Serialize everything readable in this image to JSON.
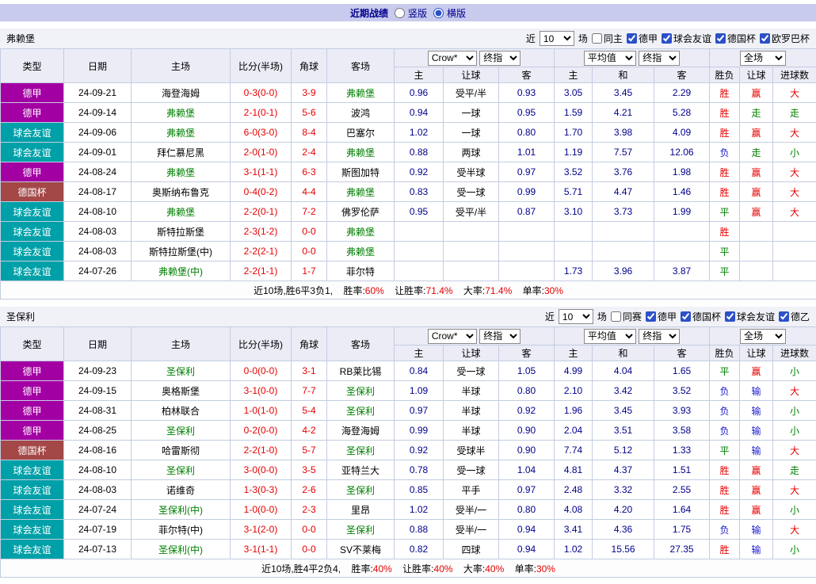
{
  "topbar": {
    "title": "近期战绩",
    "layout_options": [
      {
        "label": "竖版",
        "selected": false
      },
      {
        "label": "横版",
        "selected": true
      }
    ]
  },
  "colors": {
    "accent_bar": "#c8caee",
    "type_badges": {
      "德甲": "#a300a3",
      "球会友谊": "#00a0a8",
      "德国杯": "#a34747"
    },
    "results": {
      "胜": "#e60000",
      "赢": "#e60000",
      "大": "#e60000",
      "平": "#008000",
      "走": "#008000",
      "小": "#008000",
      "负": "#1a1acc",
      "输": "#1a1acc"
    }
  },
  "table_header": {
    "type": "类型",
    "date": "日期",
    "home": "主场",
    "score": "比分(半场)",
    "corner": "角球",
    "away": "客场",
    "odds_source_select": "Crow*",
    "odds_index_select": "终指",
    "avg_select": "平均值",
    "avg_index_select": "终指",
    "scope_select": "全场",
    "sub_headers": [
      "主",
      "让球",
      "客",
      "主",
      "和",
      "客",
      "胜负",
      "让球",
      "进球数"
    ]
  },
  "sections": [
    {
      "team": "弗赖堡",
      "filter": {
        "near": "近",
        "count": "10",
        "games": "场",
        "same": {
          "label": "同主",
          "checked": false
        },
        "leagues": [
          {
            "label": "德甲",
            "checked": true
          },
          {
            "label": "球会友谊",
            "checked": true
          },
          {
            "label": "德国杯",
            "checked": true
          },
          {
            "label": "欧罗巴杯",
            "checked": true
          }
        ]
      },
      "rows": [
        {
          "type": "德甲",
          "date": "24-09-21",
          "home": "海登海姆",
          "home_focus": false,
          "score": "0-3(0-0)",
          "corner": "3-9",
          "away": "弗赖堡",
          "away_focus": true,
          "odds": [
            "0.96",
            "受平/半",
            "0.93"
          ],
          "avg": [
            "3.05",
            "3.45",
            "2.29"
          ],
          "results": [
            "胜",
            "赢",
            "大"
          ]
        },
        {
          "type": "德甲",
          "date": "24-09-14",
          "home": "弗赖堡",
          "home_focus": true,
          "score": "2-1(0-1)",
          "corner": "5-6",
          "away": "波鸿",
          "away_focus": false,
          "odds": [
            "0.94",
            "一球",
            "0.95"
          ],
          "avg": [
            "1.59",
            "4.21",
            "5.28"
          ],
          "results": [
            "胜",
            "走",
            "走"
          ]
        },
        {
          "type": "球会友谊",
          "date": "24-09-06",
          "home": "弗赖堡",
          "home_focus": true,
          "score": "6-0(3-0)",
          "corner": "8-4",
          "away": "巴塞尔",
          "away_focus": false,
          "odds": [
            "1.02",
            "一球",
            "0.80"
          ],
          "avg": [
            "1.70",
            "3.98",
            "4.09"
          ],
          "results": [
            "胜",
            "赢",
            "大"
          ]
        },
        {
          "type": "球会友谊",
          "date": "24-09-01",
          "home": "拜仁慕尼黑",
          "home_focus": false,
          "score": "2-0(1-0)",
          "corner": "2-4",
          "away": "弗赖堡",
          "away_focus": true,
          "odds": [
            "0.88",
            "两球",
            "1.01"
          ],
          "avg": [
            "1.19",
            "7.57",
            "12.06"
          ],
          "results": [
            "负",
            "走",
            "小"
          ]
        },
        {
          "type": "德甲",
          "date": "24-08-24",
          "home": "弗赖堡",
          "home_focus": true,
          "score": "3-1(1-1)",
          "corner": "6-3",
          "away": "斯图加特",
          "away_focus": false,
          "odds": [
            "0.92",
            "受半球",
            "0.97"
          ],
          "avg": [
            "3.52",
            "3.76",
            "1.98"
          ],
          "results": [
            "胜",
            "赢",
            "大"
          ]
        },
        {
          "type": "德国杯",
          "date": "24-08-17",
          "home": "奥斯纳布鲁克",
          "home_focus": false,
          "score": "0-4(0-2)",
          "corner": "4-4",
          "away": "弗赖堡",
          "away_focus": true,
          "odds": [
            "0.83",
            "受一球",
            "0.99"
          ],
          "avg": [
            "5.71",
            "4.47",
            "1.46"
          ],
          "results": [
            "胜",
            "赢",
            "大"
          ]
        },
        {
          "type": "球会友谊",
          "date": "24-08-10",
          "home": "弗赖堡",
          "home_focus": true,
          "score": "2-2(0-1)",
          "corner": "7-2",
          "away": "佛罗伦萨",
          "away_focus": false,
          "odds": [
            "0.95",
            "受平/半",
            "0.87"
          ],
          "avg": [
            "3.10",
            "3.73",
            "1.99"
          ],
          "results": [
            "平",
            "赢",
            "大"
          ]
        },
        {
          "type": "球会友谊",
          "date": "24-08-03",
          "home": "斯特拉斯堡",
          "home_focus": false,
          "score": "2-3(1-2)",
          "corner": "0-0",
          "away": "弗赖堡",
          "away_focus": true,
          "odds": [
            "",
            "",
            ""
          ],
          "avg": [
            "",
            "",
            ""
          ],
          "results": [
            "胜",
            "",
            ""
          ]
        },
        {
          "type": "球会友谊",
          "date": "24-08-03",
          "home": "斯特拉斯堡(中)",
          "home_focus": false,
          "score": "2-2(2-1)",
          "corner": "0-0",
          "away": "弗赖堡",
          "away_focus": true,
          "odds": [
            "",
            "",
            ""
          ],
          "avg": [
            "",
            "",
            ""
          ],
          "results": [
            "平",
            "",
            ""
          ]
        },
        {
          "type": "球会友谊",
          "date": "24-07-26",
          "home": "弗赖堡(中)",
          "home_focus": true,
          "score": "2-2(1-1)",
          "corner": "1-7",
          "away": "菲尔特",
          "away_focus": false,
          "odds": [
            "",
            "",
            ""
          ],
          "avg": [
            "1.73",
            "3.96",
            "3.87"
          ],
          "results": [
            "平",
            "",
            ""
          ]
        }
      ],
      "summary": {
        "prefix": "近10场,胜6平3负1,",
        "stats": [
          {
            "label": "胜率:",
            "value": "60%"
          },
          {
            "label": "让胜率:",
            "value": "71.4%"
          },
          {
            "label": "大率:",
            "value": "71.4%"
          },
          {
            "label": "单率:",
            "value": "30%"
          }
        ]
      }
    },
    {
      "team": "圣保利",
      "filter": {
        "near": "近",
        "count": "10",
        "games": "场",
        "same": {
          "label": "同赛",
          "checked": false
        },
        "leagues": [
          {
            "label": "德甲",
            "checked": true
          },
          {
            "label": "德国杯",
            "checked": true
          },
          {
            "label": "球会友谊",
            "checked": true
          },
          {
            "label": "德乙",
            "checked": true
          }
        ]
      },
      "rows": [
        {
          "type": "德甲",
          "date": "24-09-23",
          "home": "圣保利",
          "home_focus": true,
          "score": "0-0(0-0)",
          "corner": "3-1",
          "away": "RB莱比锡",
          "away_focus": false,
          "odds": [
            "0.84",
            "受一球",
            "1.05"
          ],
          "avg": [
            "4.99",
            "4.04",
            "1.65"
          ],
          "results": [
            "平",
            "赢",
            "小"
          ]
        },
        {
          "type": "德甲",
          "date": "24-09-15",
          "home": "奥格斯堡",
          "home_focus": false,
          "score": "3-1(0-0)",
          "corner": "7-7",
          "away": "圣保利",
          "away_focus": true,
          "odds": [
            "1.09",
            "半球",
            "0.80"
          ],
          "avg": [
            "2.10",
            "3.42",
            "3.52"
          ],
          "results": [
            "负",
            "输",
            "大"
          ]
        },
        {
          "type": "德甲",
          "date": "24-08-31",
          "home": "柏林联合",
          "home_focus": false,
          "score": "1-0(1-0)",
          "corner": "5-4",
          "away": "圣保利",
          "away_focus": true,
          "odds": [
            "0.97",
            "半球",
            "0.92"
          ],
          "avg": [
            "1.96",
            "3.45",
            "3.93"
          ],
          "results": [
            "负",
            "输",
            "小"
          ]
        },
        {
          "type": "德甲",
          "date": "24-08-25",
          "home": "圣保利",
          "home_focus": true,
          "score": "0-2(0-0)",
          "corner": "4-2",
          "away": "海登海姆",
          "away_focus": false,
          "odds": [
            "0.99",
            "半球",
            "0.90"
          ],
          "avg": [
            "2.04",
            "3.51",
            "3.58"
          ],
          "results": [
            "负",
            "输",
            "小"
          ]
        },
        {
          "type": "德国杯",
          "date": "24-08-16",
          "home": "哈雷斯彻",
          "home_focus": false,
          "score": "2-2(1-0)",
          "corner": "5-7",
          "away": "圣保利",
          "away_focus": true,
          "odds": [
            "0.92",
            "受球半",
            "0.90"
          ],
          "avg": [
            "7.74",
            "5.12",
            "1.33"
          ],
          "results": [
            "平",
            "输",
            "大"
          ]
        },
        {
          "type": "球会友谊",
          "date": "24-08-10",
          "home": "圣保利",
          "home_focus": true,
          "score": "3-0(0-0)",
          "corner": "3-5",
          "away": "亚特兰大",
          "away_focus": false,
          "odds": [
            "0.78",
            "受一球",
            "1.04"
          ],
          "avg": [
            "4.81",
            "4.37",
            "1.51"
          ],
          "results": [
            "胜",
            "赢",
            "走"
          ]
        },
        {
          "type": "球会友谊",
          "date": "24-08-03",
          "home": "诺维奇",
          "home_focus": false,
          "score": "1-3(0-3)",
          "corner": "2-6",
          "away": "圣保利",
          "away_focus": true,
          "odds": [
            "0.85",
            "平手",
            "0.97"
          ],
          "avg": [
            "2.48",
            "3.32",
            "2.55"
          ],
          "results": [
            "胜",
            "赢",
            "大"
          ]
        },
        {
          "type": "球会友谊",
          "date": "24-07-24",
          "home": "圣保利(中)",
          "home_focus": true,
          "score": "1-0(0-0)",
          "corner": "2-3",
          "away": "里昂",
          "away_focus": false,
          "odds": [
            "1.02",
            "受半/一",
            "0.80"
          ],
          "avg": [
            "4.08",
            "4.20",
            "1.64"
          ],
          "results": [
            "胜",
            "赢",
            "小"
          ]
        },
        {
          "type": "球会友谊",
          "date": "24-07-19",
          "home": "菲尔特(中)",
          "home_focus": false,
          "score": "3-1(2-0)",
          "corner": "0-0",
          "away": "圣保利",
          "away_focus": true,
          "odds": [
            "0.88",
            "受半/一",
            "0.94"
          ],
          "avg": [
            "3.41",
            "4.36",
            "1.75"
          ],
          "results": [
            "负",
            "输",
            "大"
          ]
        },
        {
          "type": "球会友谊",
          "date": "24-07-13",
          "home": "圣保利(中)",
          "home_focus": true,
          "score": "3-1(1-1)",
          "corner": "0-0",
          "away": "SV不莱梅",
          "away_focus": false,
          "odds": [
            "0.82",
            "四球",
            "0.94"
          ],
          "avg": [
            "1.02",
            "15.56",
            "27.35"
          ],
          "results": [
            "胜",
            "输",
            "小"
          ]
        }
      ],
      "summary": {
        "prefix": "近10场,胜4平2负4,",
        "stats": [
          {
            "label": "胜率:",
            "value": "40%"
          },
          {
            "label": "让胜率:",
            "value": "40%"
          },
          {
            "label": "大率:",
            "value": "40%"
          },
          {
            "label": "单率:",
            "value": "30%"
          }
        ]
      }
    }
  ]
}
